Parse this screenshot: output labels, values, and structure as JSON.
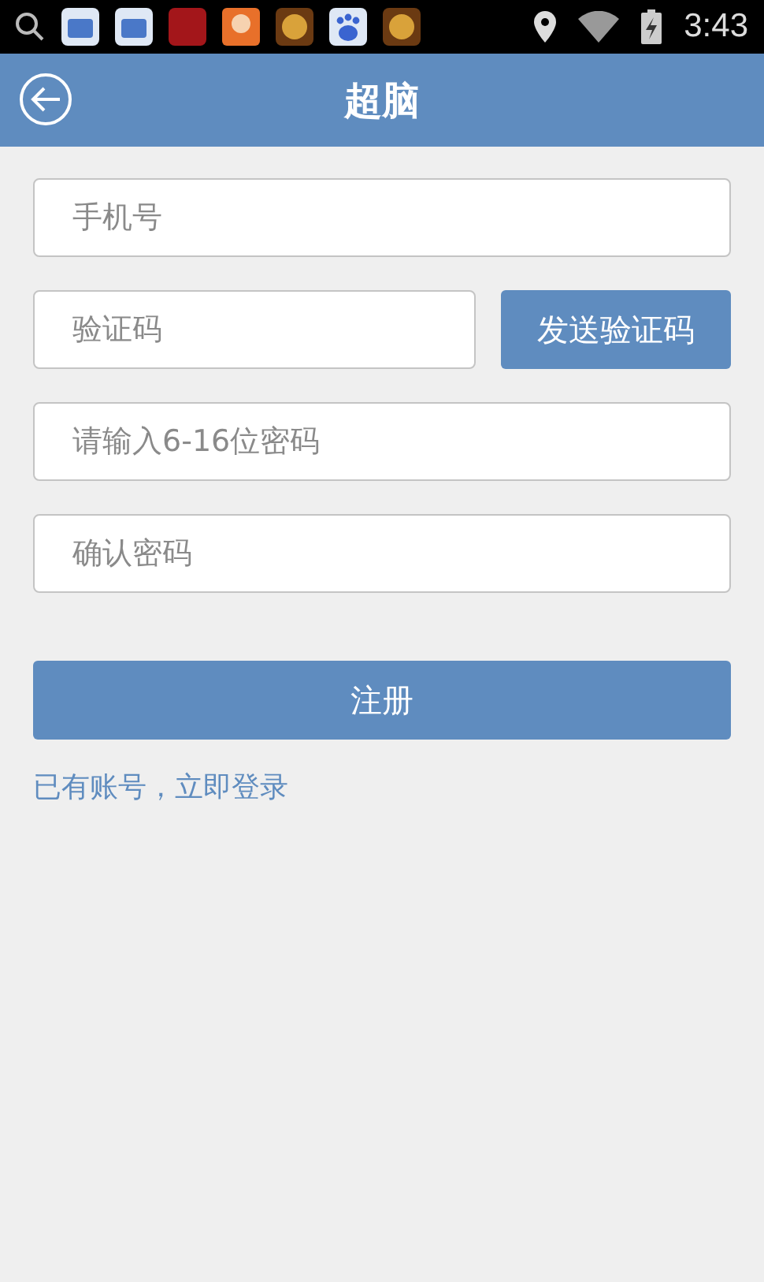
{
  "status_bar": {
    "time": "3:43"
  },
  "header": {
    "title": "超脑"
  },
  "form": {
    "phone": {
      "placeholder": "手机号"
    },
    "code": {
      "placeholder": "验证码"
    },
    "send_code_button": "发送验证码",
    "password": {
      "placeholder": "请输入6-16位密码"
    },
    "confirm_password": {
      "placeholder": "确认密码"
    },
    "register_button": "注册",
    "login_link": "已有账号，立即登录"
  }
}
